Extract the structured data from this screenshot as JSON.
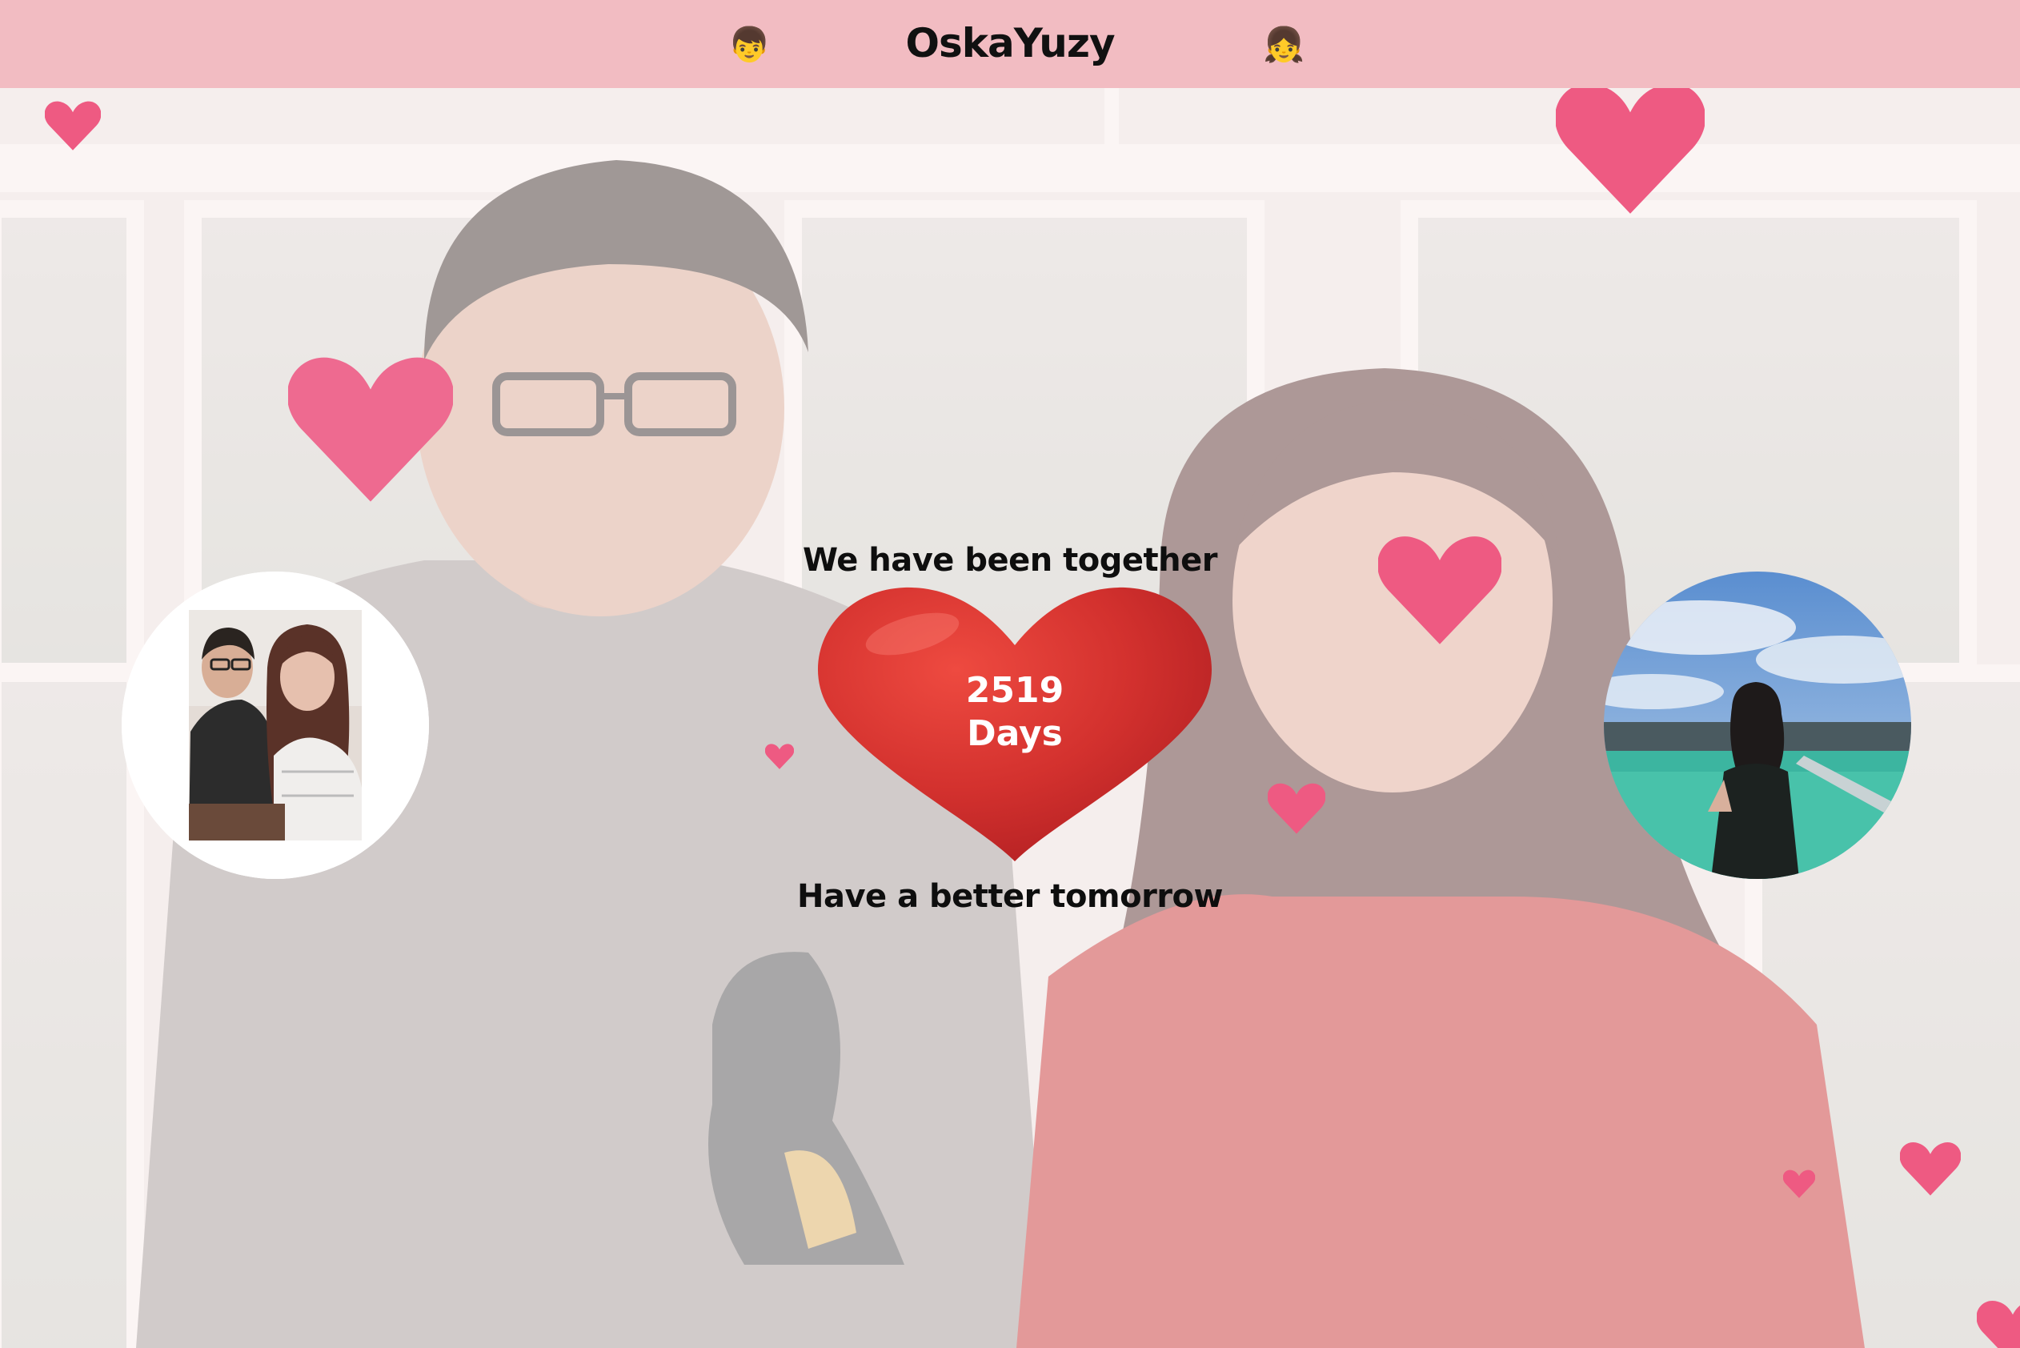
{
  "header": {
    "title": "OskaYuzy",
    "left_emoji": "👦",
    "right_emoji": "👧",
    "background_color": "#f2bcc2"
  },
  "counter": {
    "intro": "We have been together",
    "days_value": "2519",
    "days_unit": "Days",
    "outro": "Have a better tomorrow",
    "heart_color": "#d3312e"
  },
  "avatars": {
    "left": "couple-photo",
    "right": "seaside-photo"
  },
  "colors": {
    "floating_heart": "#ee5a82",
    "fade_overlay": "#fff4f4"
  }
}
